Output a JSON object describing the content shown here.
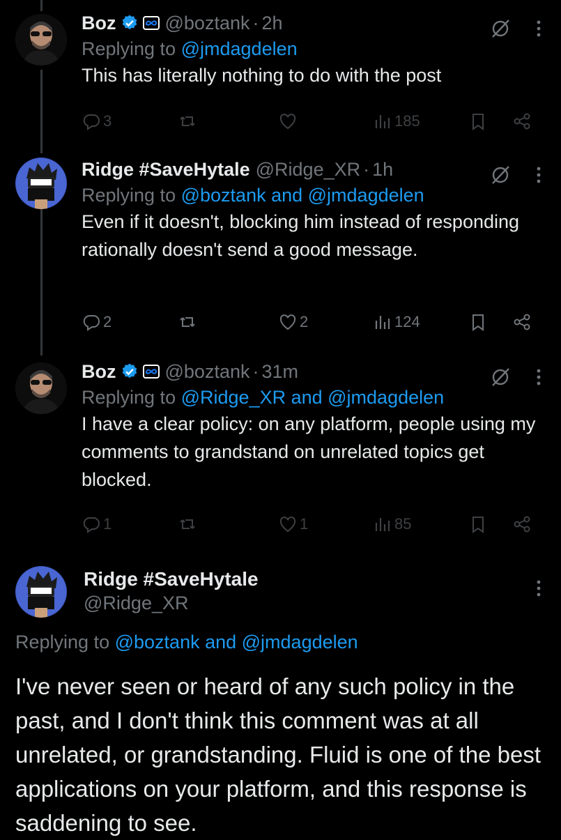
{
  "tweets": [
    {
      "name": "Boz",
      "handle": "@boztank",
      "time": "2h",
      "reply_prefix": "Replying to",
      "reply_mentions": "@jmdagdelen",
      "text": "This has literally nothing to do with the post",
      "replies": "3",
      "retweets": "",
      "likes": "",
      "views": "185"
    },
    {
      "name": "Ridge #SaveHytale",
      "handle": "@Ridge_XR",
      "time": "1h",
      "reply_prefix": "Replying to",
      "reply_mentions": "@boztank and @jmdagdelen",
      "text": "Even if it doesn't, blocking him instead of responding rationally doesn't send a good message.",
      "replies": "2",
      "retweets": "",
      "likes": "2",
      "views": "124"
    },
    {
      "name": "Boz",
      "handle": "@boztank",
      "time": "31m",
      "reply_prefix": "Replying to",
      "reply_mentions": "@Ridge_XR and @jmdagdelen",
      "text": "I have a clear policy: on any platform, people using my comments to grandstand on unrelated topics get blocked.",
      "replies": "1",
      "retweets": "",
      "likes": "1",
      "views": "85"
    }
  ],
  "focus": {
    "name": "Ridge #SaveHytale",
    "handle": "@Ridge_XR",
    "reply_prefix": "Replying to",
    "reply_mentions": "@boztank and @jmdagdelen",
    "text": "I've never seen or heard of any such policy in the past, and I don't think this comment was at all unrelated, or grandstanding. Fluid is one of the best applications on your platform, and this response is saddening to see."
  },
  "colors": {
    "background": "#000000",
    "text": "#e7e9ea",
    "muted": "#71767b",
    "link": "#1d9bf0",
    "thread_line": "#333639"
  },
  "icons": [
    "verified-badge-icon",
    "meta-logo-icon",
    "grok-icon",
    "more-icon",
    "reply-icon",
    "retweet-icon",
    "like-icon",
    "views-icon",
    "bookmark-icon",
    "share-icon"
  ]
}
